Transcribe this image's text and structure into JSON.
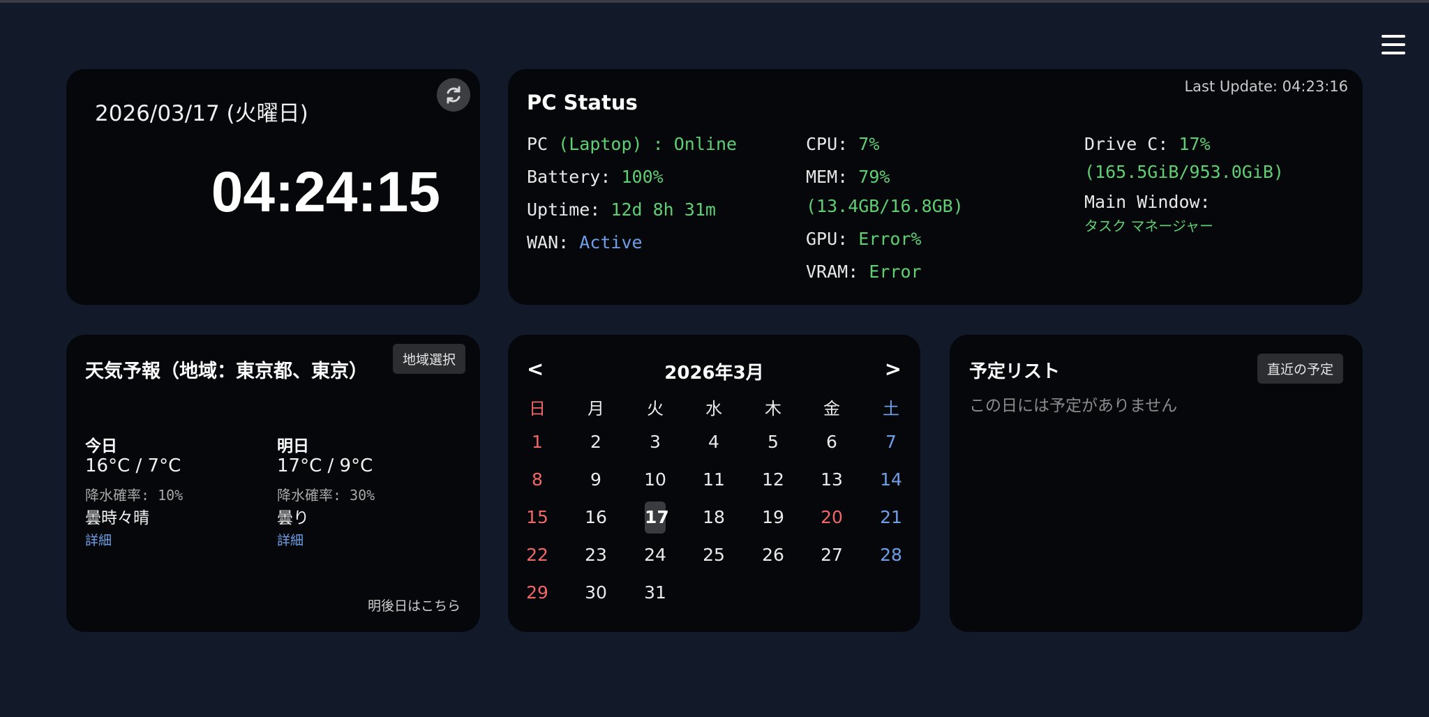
{
  "clock": {
    "date": "2026/03/17 (火曜日)",
    "time": "04:24:15"
  },
  "pc_status": {
    "title": "PC Status",
    "last_update": "Last Update: 04:23:16",
    "pc_label": "PC",
    "pc_value": "(Laptop) : Online",
    "battery_label": "Battery:",
    "battery_value": "100%",
    "uptime_label": "Uptime:",
    "uptime_value": "12d 8h 31m",
    "wan_label": "WAN:",
    "wan_value": "Active",
    "cpu_label": "CPU:",
    "cpu_value": "7%",
    "mem_label": "MEM:",
    "mem_value": "79%",
    "mem_detail": "(13.4GB/16.8GB)",
    "gpu_label": "GPU:",
    "gpu_value": "Error%",
    "vram_label": "VRAM:",
    "vram_value": "Error",
    "drive_label": "Drive C:",
    "drive_value": "17%",
    "drive_detail": "(165.5GiB/953.0GiB)",
    "window_label": "Main Window:",
    "window_value": "タスク マネージャー"
  },
  "weather": {
    "title": "天気予報（地域：東京都、東京）",
    "region_button": "地域選択",
    "days": [
      {
        "label": "今日",
        "temp": "16°C / 7°C",
        "rain": "降水確率: 10%",
        "condition": "曇時々晴",
        "link": "詳細"
      },
      {
        "label": "明日",
        "temp": "17°C / 9°C",
        "rain": "降水確率: 30%",
        "condition": "曇り",
        "link": "詳細"
      }
    ],
    "more_link": "明後日はこちら"
  },
  "calendar": {
    "prev": "<",
    "next": ">",
    "title": "2026年3月",
    "weekdays": [
      "日",
      "月",
      "火",
      "水",
      "木",
      "金",
      "土"
    ],
    "first_weekday_index": 0,
    "days_in_month": 31,
    "today": 17,
    "holidays": [
      20
    ]
  },
  "schedule": {
    "title": "予定リスト",
    "button": "直近の予定",
    "empty_text": "この日には予定がありません"
  },
  "colors": {
    "background": "#121a2a",
    "card": "#06070b",
    "green": "#5fcf73",
    "blue": "#6f9fe6",
    "red": "#ef6868"
  },
  "icons": {
    "menu": "hamburger-menu-icon",
    "refresh": "refresh-icon"
  }
}
